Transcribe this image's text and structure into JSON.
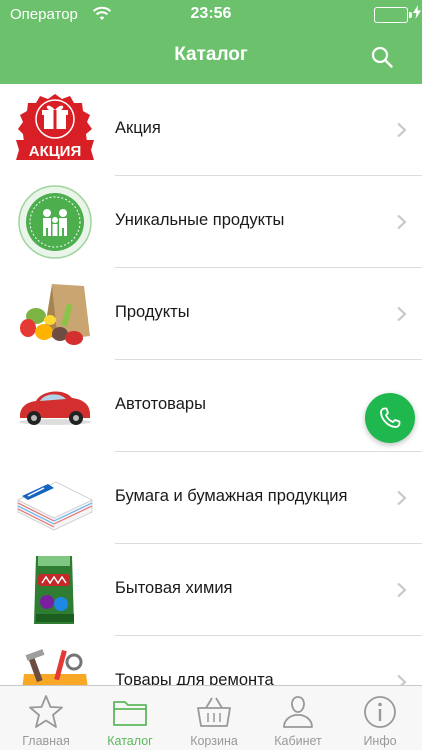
{
  "status_bar": {
    "carrier": "Оператор",
    "time": "23:56",
    "wifi_icon": "wifi-icon",
    "battery_icon": "battery-icon"
  },
  "nav": {
    "title": "Каталог",
    "search_icon": "search-icon"
  },
  "catalog": {
    "items": [
      {
        "label": "Акция",
        "icon": "sale-badge-image"
      },
      {
        "label": "Уникальные продукты",
        "icon": "family-club-logo-image"
      },
      {
        "label": "Продукты",
        "icon": "groceries-image"
      },
      {
        "label": "Автотовары",
        "icon": "red-car-image"
      },
      {
        "label": "Бумага и бумажная продукция",
        "icon": "paper-stack-image"
      },
      {
        "label": "Бытовая химия",
        "icon": "detergent-pack-image"
      },
      {
        "label": "Товары для ремонта",
        "icon": "tools-image"
      }
    ],
    "sale_badge_text": "АКЦИЯ"
  },
  "tab_bar": {
    "tabs": [
      {
        "label": "Главная",
        "icon": "star-icon",
        "active": false
      },
      {
        "label": "Каталог",
        "icon": "folder-icon",
        "active": true
      },
      {
        "label": "Корзина",
        "icon": "basket-icon",
        "active": false
      },
      {
        "label": "Кабинет",
        "icon": "person-icon",
        "active": false
      },
      {
        "label": "Инфо",
        "icon": "info-icon",
        "active": false
      }
    ]
  },
  "colors": {
    "accent": "#6cc26c",
    "active_tab": "#5cb85c",
    "call_button": "#1fb84f",
    "chevron": "#c7c7cc"
  }
}
